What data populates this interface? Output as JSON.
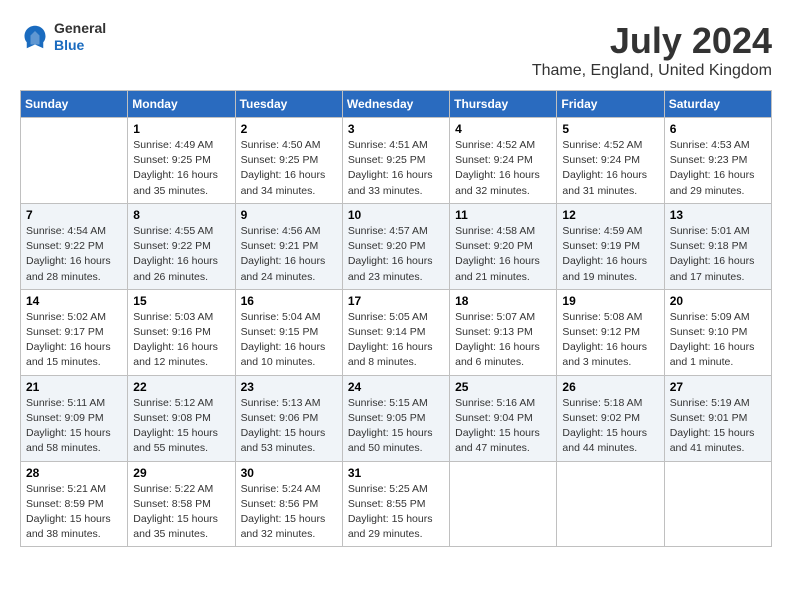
{
  "header": {
    "logo_general": "General",
    "logo_blue": "Blue",
    "title": "July 2024",
    "subtitle": "Thame, England, United Kingdom"
  },
  "columns": [
    "Sunday",
    "Monday",
    "Tuesday",
    "Wednesday",
    "Thursday",
    "Friday",
    "Saturday"
  ],
  "rows": [
    [
      {
        "day": "",
        "text": ""
      },
      {
        "day": "1",
        "text": "Sunrise: 4:49 AM\nSunset: 9:25 PM\nDaylight: 16 hours\nand 35 minutes."
      },
      {
        "day": "2",
        "text": "Sunrise: 4:50 AM\nSunset: 9:25 PM\nDaylight: 16 hours\nand 34 minutes."
      },
      {
        "day": "3",
        "text": "Sunrise: 4:51 AM\nSunset: 9:25 PM\nDaylight: 16 hours\nand 33 minutes."
      },
      {
        "day": "4",
        "text": "Sunrise: 4:52 AM\nSunset: 9:24 PM\nDaylight: 16 hours\nand 32 minutes."
      },
      {
        "day": "5",
        "text": "Sunrise: 4:52 AM\nSunset: 9:24 PM\nDaylight: 16 hours\nand 31 minutes."
      },
      {
        "day": "6",
        "text": "Sunrise: 4:53 AM\nSunset: 9:23 PM\nDaylight: 16 hours\nand 29 minutes."
      }
    ],
    [
      {
        "day": "7",
        "text": "Sunrise: 4:54 AM\nSunset: 9:22 PM\nDaylight: 16 hours\nand 28 minutes."
      },
      {
        "day": "8",
        "text": "Sunrise: 4:55 AM\nSunset: 9:22 PM\nDaylight: 16 hours\nand 26 minutes."
      },
      {
        "day": "9",
        "text": "Sunrise: 4:56 AM\nSunset: 9:21 PM\nDaylight: 16 hours\nand 24 minutes."
      },
      {
        "day": "10",
        "text": "Sunrise: 4:57 AM\nSunset: 9:20 PM\nDaylight: 16 hours\nand 23 minutes."
      },
      {
        "day": "11",
        "text": "Sunrise: 4:58 AM\nSunset: 9:20 PM\nDaylight: 16 hours\nand 21 minutes."
      },
      {
        "day": "12",
        "text": "Sunrise: 4:59 AM\nSunset: 9:19 PM\nDaylight: 16 hours\nand 19 minutes."
      },
      {
        "day": "13",
        "text": "Sunrise: 5:01 AM\nSunset: 9:18 PM\nDaylight: 16 hours\nand 17 minutes."
      }
    ],
    [
      {
        "day": "14",
        "text": "Sunrise: 5:02 AM\nSunset: 9:17 PM\nDaylight: 16 hours\nand 15 minutes."
      },
      {
        "day": "15",
        "text": "Sunrise: 5:03 AM\nSunset: 9:16 PM\nDaylight: 16 hours\nand 12 minutes."
      },
      {
        "day": "16",
        "text": "Sunrise: 5:04 AM\nSunset: 9:15 PM\nDaylight: 16 hours\nand 10 minutes."
      },
      {
        "day": "17",
        "text": "Sunrise: 5:05 AM\nSunset: 9:14 PM\nDaylight: 16 hours\nand 8 minutes."
      },
      {
        "day": "18",
        "text": "Sunrise: 5:07 AM\nSunset: 9:13 PM\nDaylight: 16 hours\nand 6 minutes."
      },
      {
        "day": "19",
        "text": "Sunrise: 5:08 AM\nSunset: 9:12 PM\nDaylight: 16 hours\nand 3 minutes."
      },
      {
        "day": "20",
        "text": "Sunrise: 5:09 AM\nSunset: 9:10 PM\nDaylight: 16 hours\nand 1 minute."
      }
    ],
    [
      {
        "day": "21",
        "text": "Sunrise: 5:11 AM\nSunset: 9:09 PM\nDaylight: 15 hours\nand 58 minutes."
      },
      {
        "day": "22",
        "text": "Sunrise: 5:12 AM\nSunset: 9:08 PM\nDaylight: 15 hours\nand 55 minutes."
      },
      {
        "day": "23",
        "text": "Sunrise: 5:13 AM\nSunset: 9:06 PM\nDaylight: 15 hours\nand 53 minutes."
      },
      {
        "day": "24",
        "text": "Sunrise: 5:15 AM\nSunset: 9:05 PM\nDaylight: 15 hours\nand 50 minutes."
      },
      {
        "day": "25",
        "text": "Sunrise: 5:16 AM\nSunset: 9:04 PM\nDaylight: 15 hours\nand 47 minutes."
      },
      {
        "day": "26",
        "text": "Sunrise: 5:18 AM\nSunset: 9:02 PM\nDaylight: 15 hours\nand 44 minutes."
      },
      {
        "day": "27",
        "text": "Sunrise: 5:19 AM\nSunset: 9:01 PM\nDaylight: 15 hours\nand 41 minutes."
      }
    ],
    [
      {
        "day": "28",
        "text": "Sunrise: 5:21 AM\nSunset: 8:59 PM\nDaylight: 15 hours\nand 38 minutes."
      },
      {
        "day": "29",
        "text": "Sunrise: 5:22 AM\nSunset: 8:58 PM\nDaylight: 15 hours\nand 35 minutes."
      },
      {
        "day": "30",
        "text": "Sunrise: 5:24 AM\nSunset: 8:56 PM\nDaylight: 15 hours\nand 32 minutes."
      },
      {
        "day": "31",
        "text": "Sunrise: 5:25 AM\nSunset: 8:55 PM\nDaylight: 15 hours\nand 29 minutes."
      },
      {
        "day": "",
        "text": ""
      },
      {
        "day": "",
        "text": ""
      },
      {
        "day": "",
        "text": ""
      }
    ]
  ]
}
